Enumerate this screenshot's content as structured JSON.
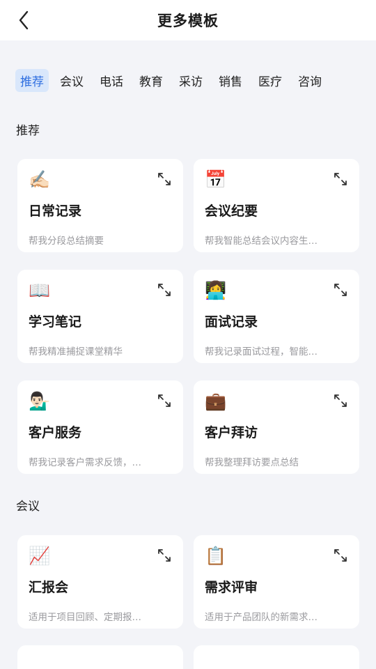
{
  "header": {
    "title": "更多模板",
    "back_icon": "chevron-left-icon"
  },
  "tabs": [
    {
      "label": "推荐",
      "active": true
    },
    {
      "label": "会议"
    },
    {
      "label": "电话"
    },
    {
      "label": "教育"
    },
    {
      "label": "采访"
    },
    {
      "label": "销售"
    },
    {
      "label": "医疗"
    },
    {
      "label": "咨询"
    }
  ],
  "sections": [
    {
      "title": "推荐",
      "cards": [
        {
          "icon": "✍🏻",
          "icon_name": "writing-hand-icon",
          "name": "日常记录",
          "desc": "帮我分段总结摘要"
        },
        {
          "icon": "📅",
          "icon_name": "calendar-icon",
          "name": "会议纪要",
          "desc": "帮我智能总结会议内容生…"
        },
        {
          "icon": "📖",
          "icon_name": "open-book-icon",
          "name": "学习笔记",
          "desc": "帮我精准捕捉课堂精华"
        },
        {
          "icon": "👩‍💻",
          "icon_name": "technologist-icon",
          "name": "面试记录",
          "desc": "帮我记录面试过程，智能…"
        },
        {
          "icon": "💁🏻‍♂️",
          "icon_name": "service-person-icon",
          "name": "客户服务",
          "desc": "帮我记录客户需求反馈，…"
        },
        {
          "icon": "💼",
          "icon_name": "briefcase-icon",
          "name": "客户拜访",
          "desc": "帮我整理拜访要点总结"
        }
      ]
    },
    {
      "title": "会议",
      "cards": [
        {
          "icon": "📈",
          "icon_name": "chart-increasing-icon",
          "name": "汇报会",
          "desc": "适用于项目回顾、定期报…"
        },
        {
          "icon": "📋",
          "icon_name": "clipboard-icon",
          "name": "需求评审",
          "desc": "适用于产品团队的新需求…"
        }
      ]
    }
  ],
  "expand_icon": "expand-arrows-icon"
}
